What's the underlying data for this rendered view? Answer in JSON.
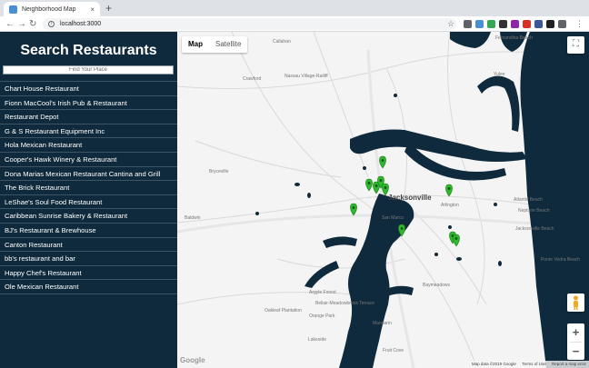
{
  "browser": {
    "tab_title": "Neighborhood Map",
    "tab_close": "×",
    "new_tab": "+",
    "url": "localhost:3000",
    "extension_colors": [
      "#5f6368",
      "#4a8fd4",
      "#34a853",
      "#333333",
      "#8e24aa",
      "#d93025",
      "#3b5998",
      "#202124",
      "#5f6368"
    ]
  },
  "sidebar": {
    "title": "Search Restaurants",
    "search_placeholder": "Find Your Place",
    "restaurants": [
      "Chart House Restaurant",
      "Fionn MacCool's Irish Pub & Restaurant",
      "Restaurant Depot",
      "G & S Restaurant Equipment Inc",
      "Hola Mexican Restaurant",
      "Cooper's Hawk Winery & Restaurant",
      "Dona Marias Mexican Restaurant Cantina and Grill",
      "The Brick Restaurant",
      "LeShae's Soul Food Restaurant",
      "Caribbean Sunrise Bakery & Restaurant",
      "BJ's Restaurant & Brewhouse",
      "Canton Restaurant",
      "bb's restaurant and bar",
      "Happy Chef's Restaurant",
      "Ole Mexican Restaurant"
    ]
  },
  "map": {
    "type_map": "Map",
    "type_satellite": "Satellite",
    "zoom_in": "+",
    "zoom_out": "−",
    "google": "Google",
    "attribution": [
      "Map data ©2019 Google",
      "Terms of Use",
      "Report a map error"
    ],
    "water_color": "#0e2a3c",
    "marker_color": "#2eb82e",
    "place_labels": [
      "Callahan",
      "Crawford",
      "Nassau Village-Ratliff",
      "Fernandina Beach",
      "Yulee",
      "Bryceville",
      "Baldwin",
      "Jacksonville",
      "Arlington",
      "Atlantic Beach",
      "Neptune Beach",
      "Jacksonville Beach",
      "San Marco",
      "Argyle Forest",
      "Bellair-Meadowbrook Terrace",
      "Oakleaf Plantation",
      "Orange Park",
      "Mandarin",
      "Ponte Vedra Beach",
      "Baymeadows",
      "Lakeside",
      "Fruit Cove"
    ]
  }
}
